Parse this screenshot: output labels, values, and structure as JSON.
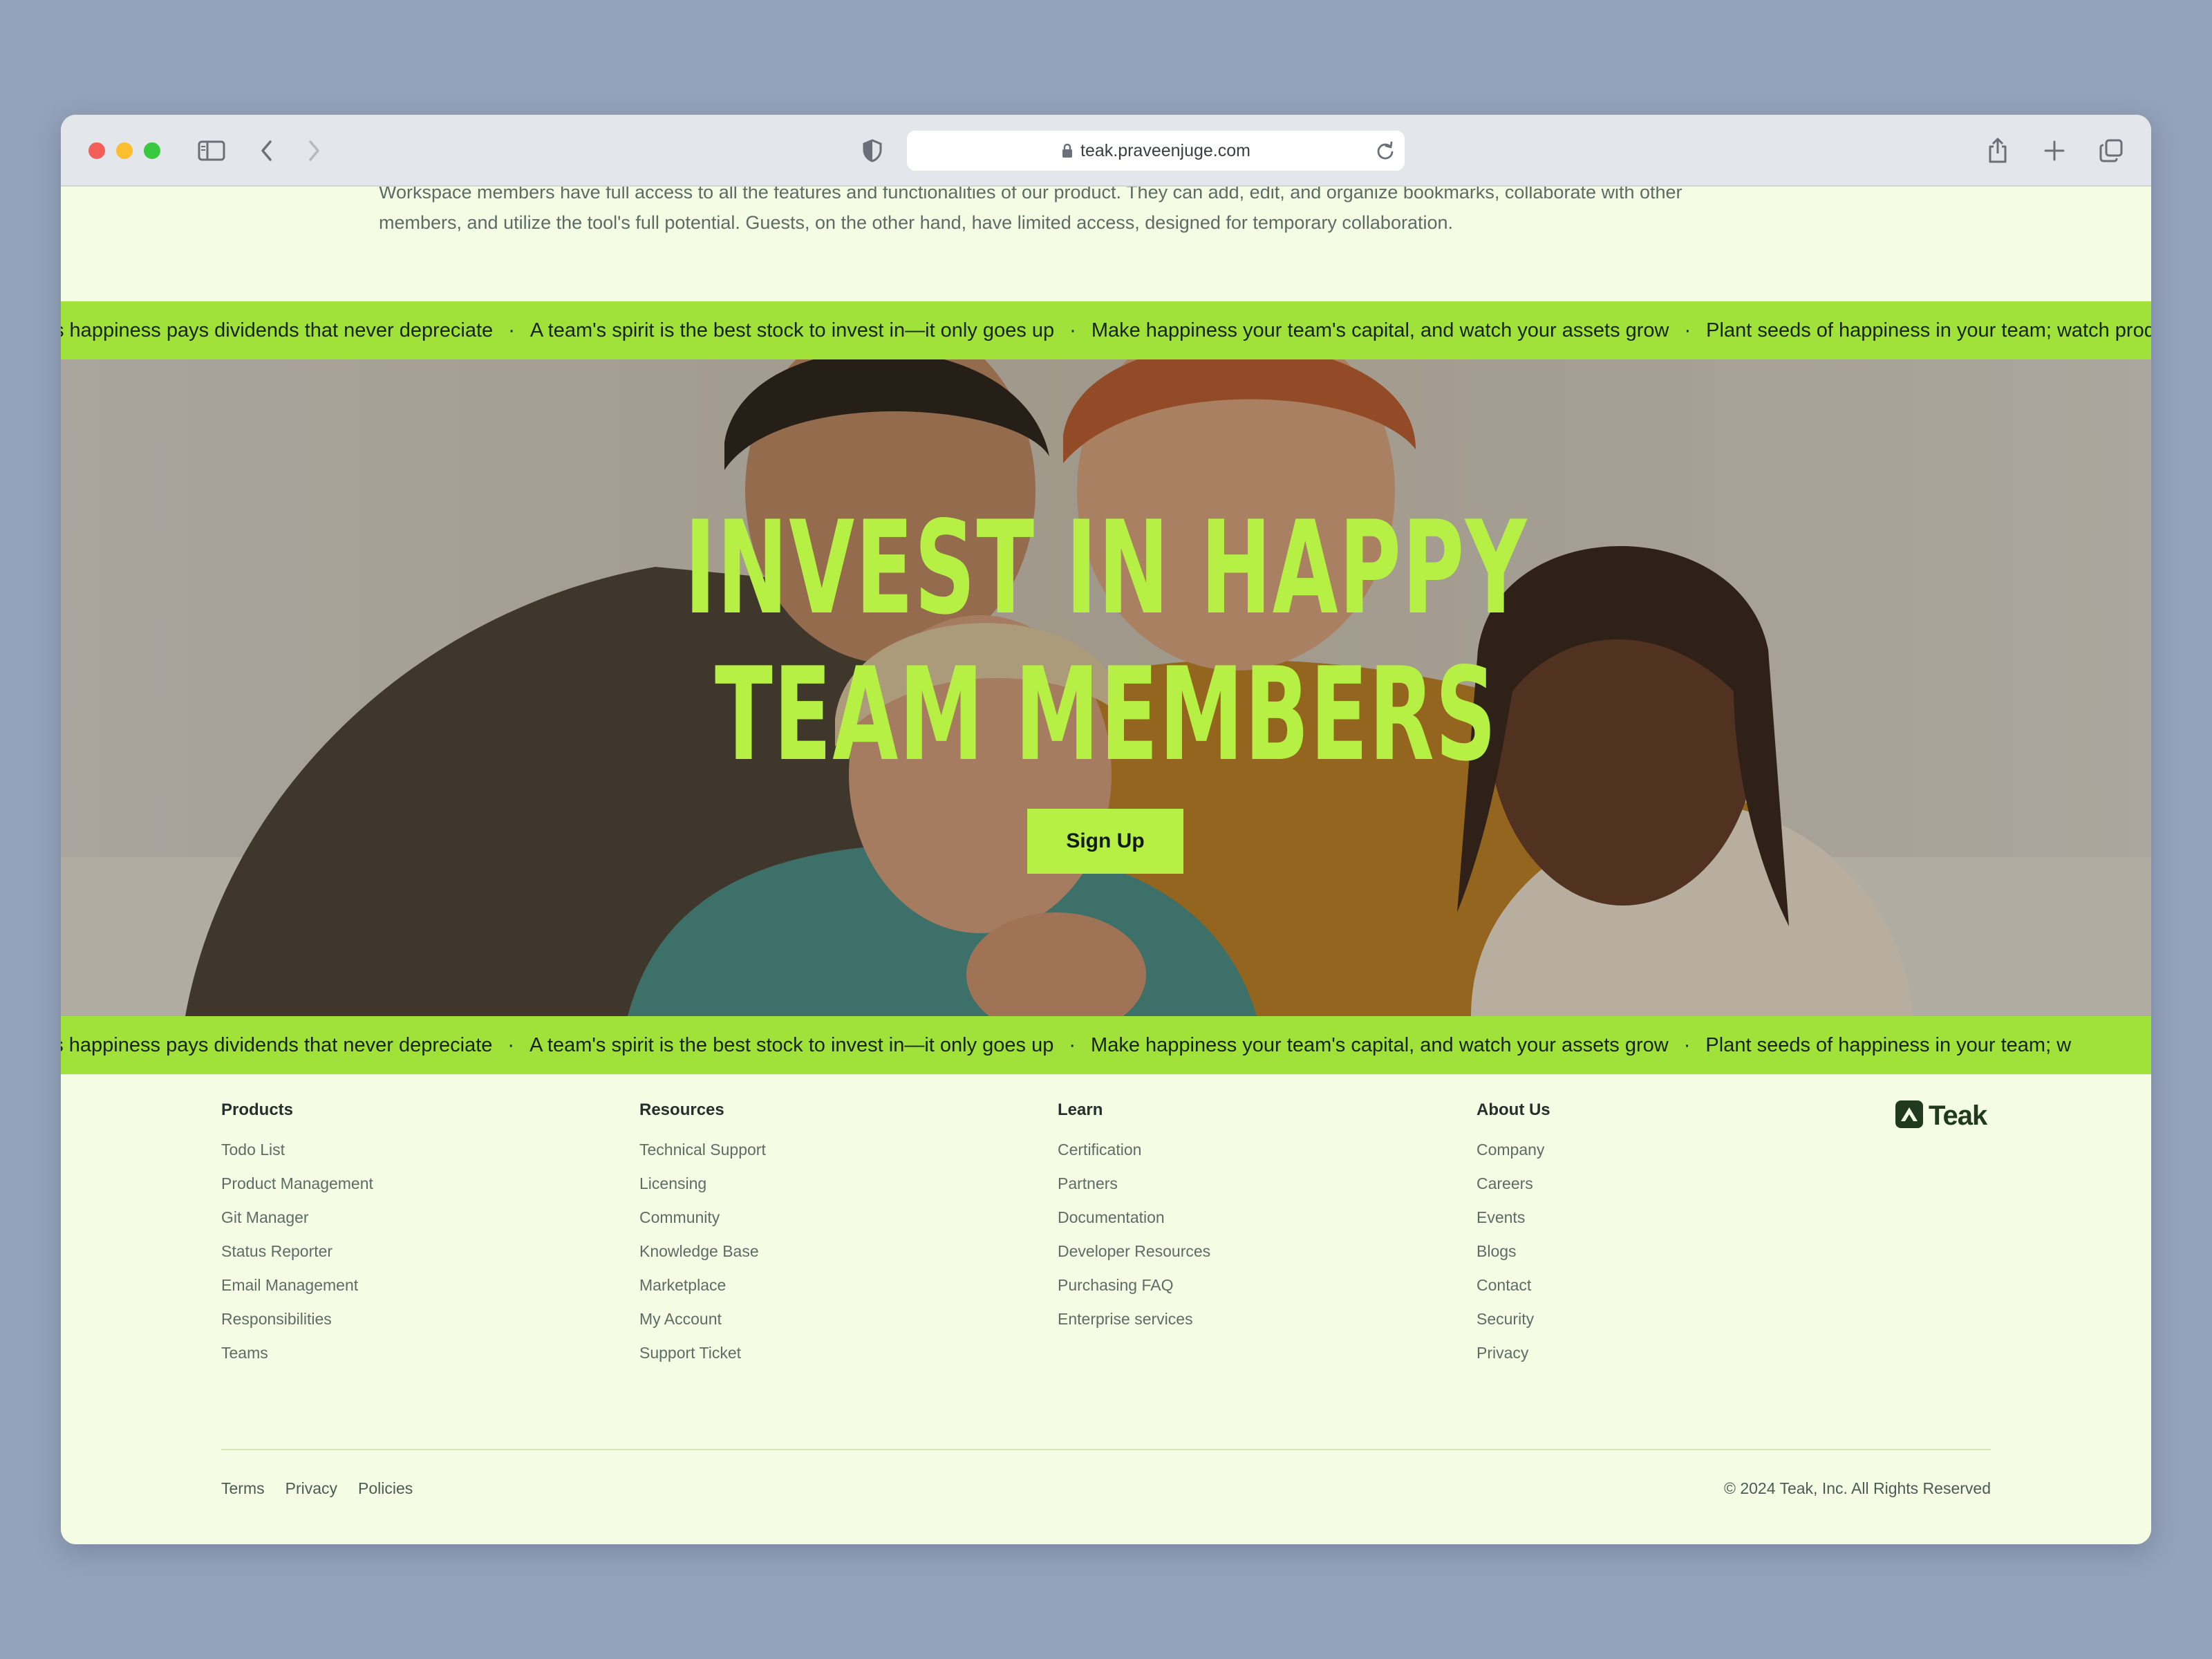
{
  "browser": {
    "url": "teak.praveenjuge.com"
  },
  "intro": {
    "line1": "Workspace members have full access to all the features and functionalities of our product. They can add, edit, and organize bookmarks, collaborate with other",
    "line2": "members, and utilize the tool's full potential. Guests, on the other hand, have limited access, designed for temporary collaboration."
  },
  "ticker_top": {
    "items": [
      "s happiness pays dividends that never depreciate",
      "A team's spirit is the best stock to invest in—it only goes up",
      "Make happiness your team's capital, and watch your assets grow",
      "Plant seeds of happiness in your team; watch productivity blo"
    ]
  },
  "ticker_bottom": {
    "items": [
      "Investing in your team's happiness pays dividends that never depreciate",
      "A team's spirit is the best stock to invest in—it only goes up",
      "Make happiness your team's capital, and watch your assets grow",
      "Plant seeds of happiness in your team; w"
    ]
  },
  "hero": {
    "title_line1": "INVEST IN HAPPY",
    "title_line2": "TEAM MEMBERS",
    "cta_label": "Sign Up"
  },
  "footer": {
    "columns": [
      {
        "heading": "Products",
        "links": [
          "Todo List",
          "Product Management",
          "Git Manager",
          "Status Reporter",
          "Email Management",
          "Responsibilities",
          "Teams"
        ]
      },
      {
        "heading": "Resources",
        "links": [
          "Technical Support",
          "Licensing",
          "Community",
          "Knowledge Base",
          "Marketplace",
          "My Account",
          "Support Ticket"
        ]
      },
      {
        "heading": "Learn",
        "links": [
          "Certification",
          "Partners",
          "Documentation",
          "Developer Resources",
          "Purchasing FAQ",
          "Enterprise services"
        ]
      },
      {
        "heading": "About Us",
        "links": [
          "Company",
          "Careers",
          "Events",
          "Blogs",
          "Contact",
          "Security",
          "Privacy"
        ]
      }
    ],
    "brand_name": "Teak",
    "legal_links": [
      "Terms",
      "Privacy",
      "Policies"
    ],
    "copyright": "© 2024 Teak, Inc. All Rights Reserved"
  },
  "colors": {
    "accent": "#b6f044",
    "ticker_bg": "#a1e23a",
    "page_bg": "#f4fde4",
    "desktop_bg": "#94a3bb"
  },
  "icons": [
    "sidebar-icon",
    "back-icon",
    "forward-icon",
    "shield-icon",
    "lock-icon",
    "reload-icon",
    "share-icon",
    "new-tab-icon",
    "tab-overview-icon",
    "teak-logo-icon"
  ]
}
